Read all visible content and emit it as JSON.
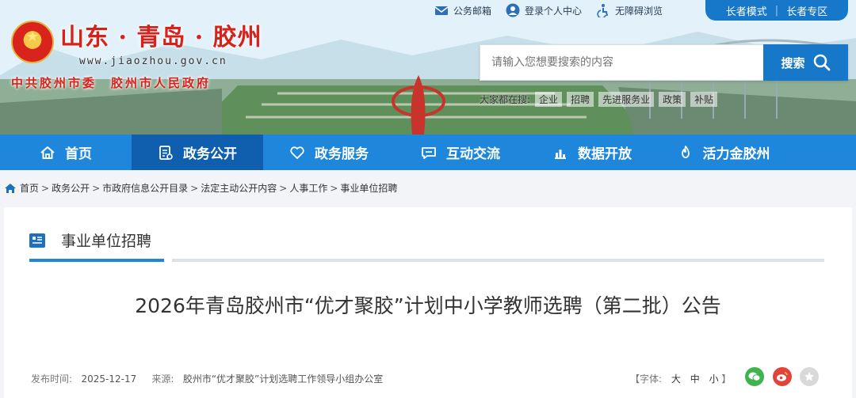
{
  "header": {
    "site_title": "山东 · 青岛 · 胶州",
    "site_url": "www.jiaozhou.gov.cn",
    "site_org": "中共胶州市委　胶州市人民政府",
    "top_links": [
      "公务邮箱",
      "登录个人中心",
      "无障碍浏览"
    ],
    "elder_mode": "长者模式",
    "elder_zone": "长者专区",
    "search": {
      "placeholder": "请输入您想要搜索的内容",
      "button": "搜索"
    },
    "hot_label": "大家都在搜:",
    "hot_words": [
      "企业",
      "招聘",
      "先进服务业",
      "政策",
      "补贴"
    ]
  },
  "nav": {
    "items": [
      {
        "label": "首页",
        "icon": "home-icon"
      },
      {
        "label": "政务公开",
        "icon": "document-icon"
      },
      {
        "label": "政务服务",
        "icon": "heart-icon"
      },
      {
        "label": "互动交流",
        "icon": "chat-icon"
      },
      {
        "label": "数据开放",
        "icon": "bar-chart-icon"
      },
      {
        "label": "活力金胶州",
        "icon": "flame-icon"
      }
    ],
    "active": "政务公开"
  },
  "breadcrumb": [
    "首页",
    "政务公开",
    "市政府信息公开目录",
    "法定主动公开内容",
    "人事工作",
    "事业单位招聘"
  ],
  "section": {
    "title": "事业单位招聘"
  },
  "article": {
    "title": "2026年青岛胶州市“优才聚胶”计划中小学教师选聘（第二批）公告",
    "publish_label": "发布时间:",
    "publish_date": "2025-12-17",
    "source_label": "来源:",
    "source": "胶州市“优才聚胶”计划选聘工作领导小组办公室",
    "font_label": "【字体:",
    "font_sizes": [
      "大",
      "中",
      "小"
    ],
    "font_close": "】"
  },
  "colors": {
    "nav_bg": "#1e87db",
    "nav_active": "#0f5fae",
    "brand_red": "#d8211b",
    "search_btn": "#1777c9"
  }
}
